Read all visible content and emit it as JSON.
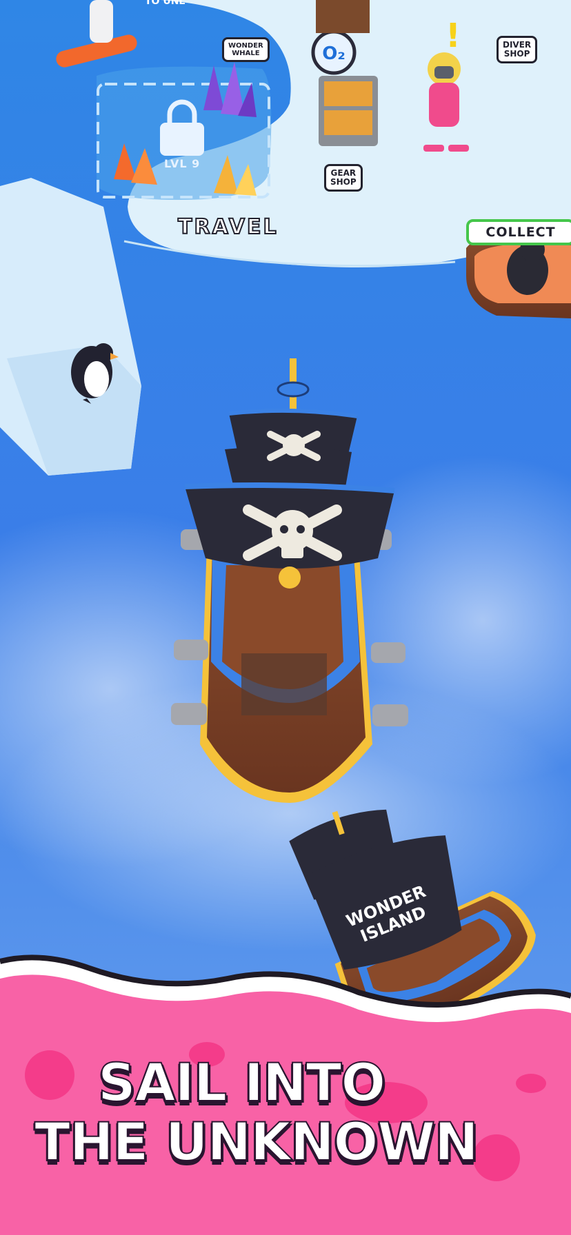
{
  "scene": {
    "water_color": "#3a86e6",
    "ice_color": "#dff1fb",
    "promo_color": "#f862a6"
  },
  "labels": {
    "unlock_hint": "TO UNL",
    "travel": "TRAVEL",
    "lock_level": "LVL 9",
    "collect": "COLLECT",
    "gear_shop": "GEAR\nSHOP",
    "diver_shop": "DIVER\nSHOP",
    "whale_sign": "WONDER\nWHALE",
    "big_ship_name": "WONDER\nISLAND"
  },
  "headline": {
    "line1": "SAIL INTO",
    "line2": "THE UNKNOWN"
  }
}
